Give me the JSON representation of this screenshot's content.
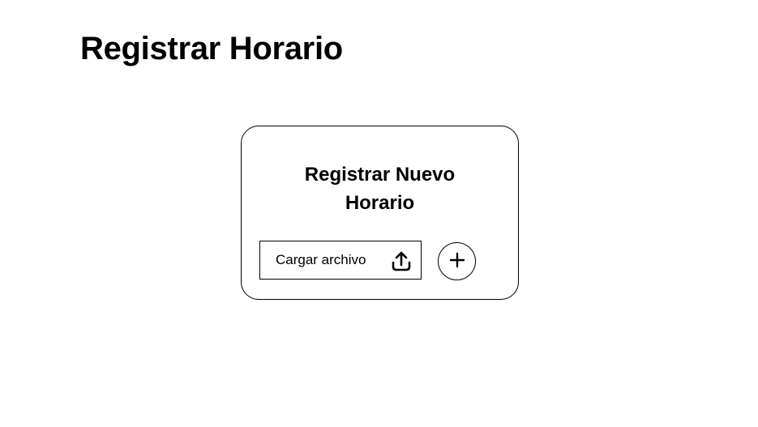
{
  "page": {
    "title": "Registrar Horario"
  },
  "card": {
    "title_line1": "Registrar Nuevo",
    "title_line2": "Horario",
    "upload_button": {
      "label": "Cargar archivo",
      "icon": "upload-icon"
    },
    "add_button": {
      "icon": "plus-icon"
    }
  },
  "colors": {
    "background": "#ffffff",
    "foreground": "#000000"
  }
}
